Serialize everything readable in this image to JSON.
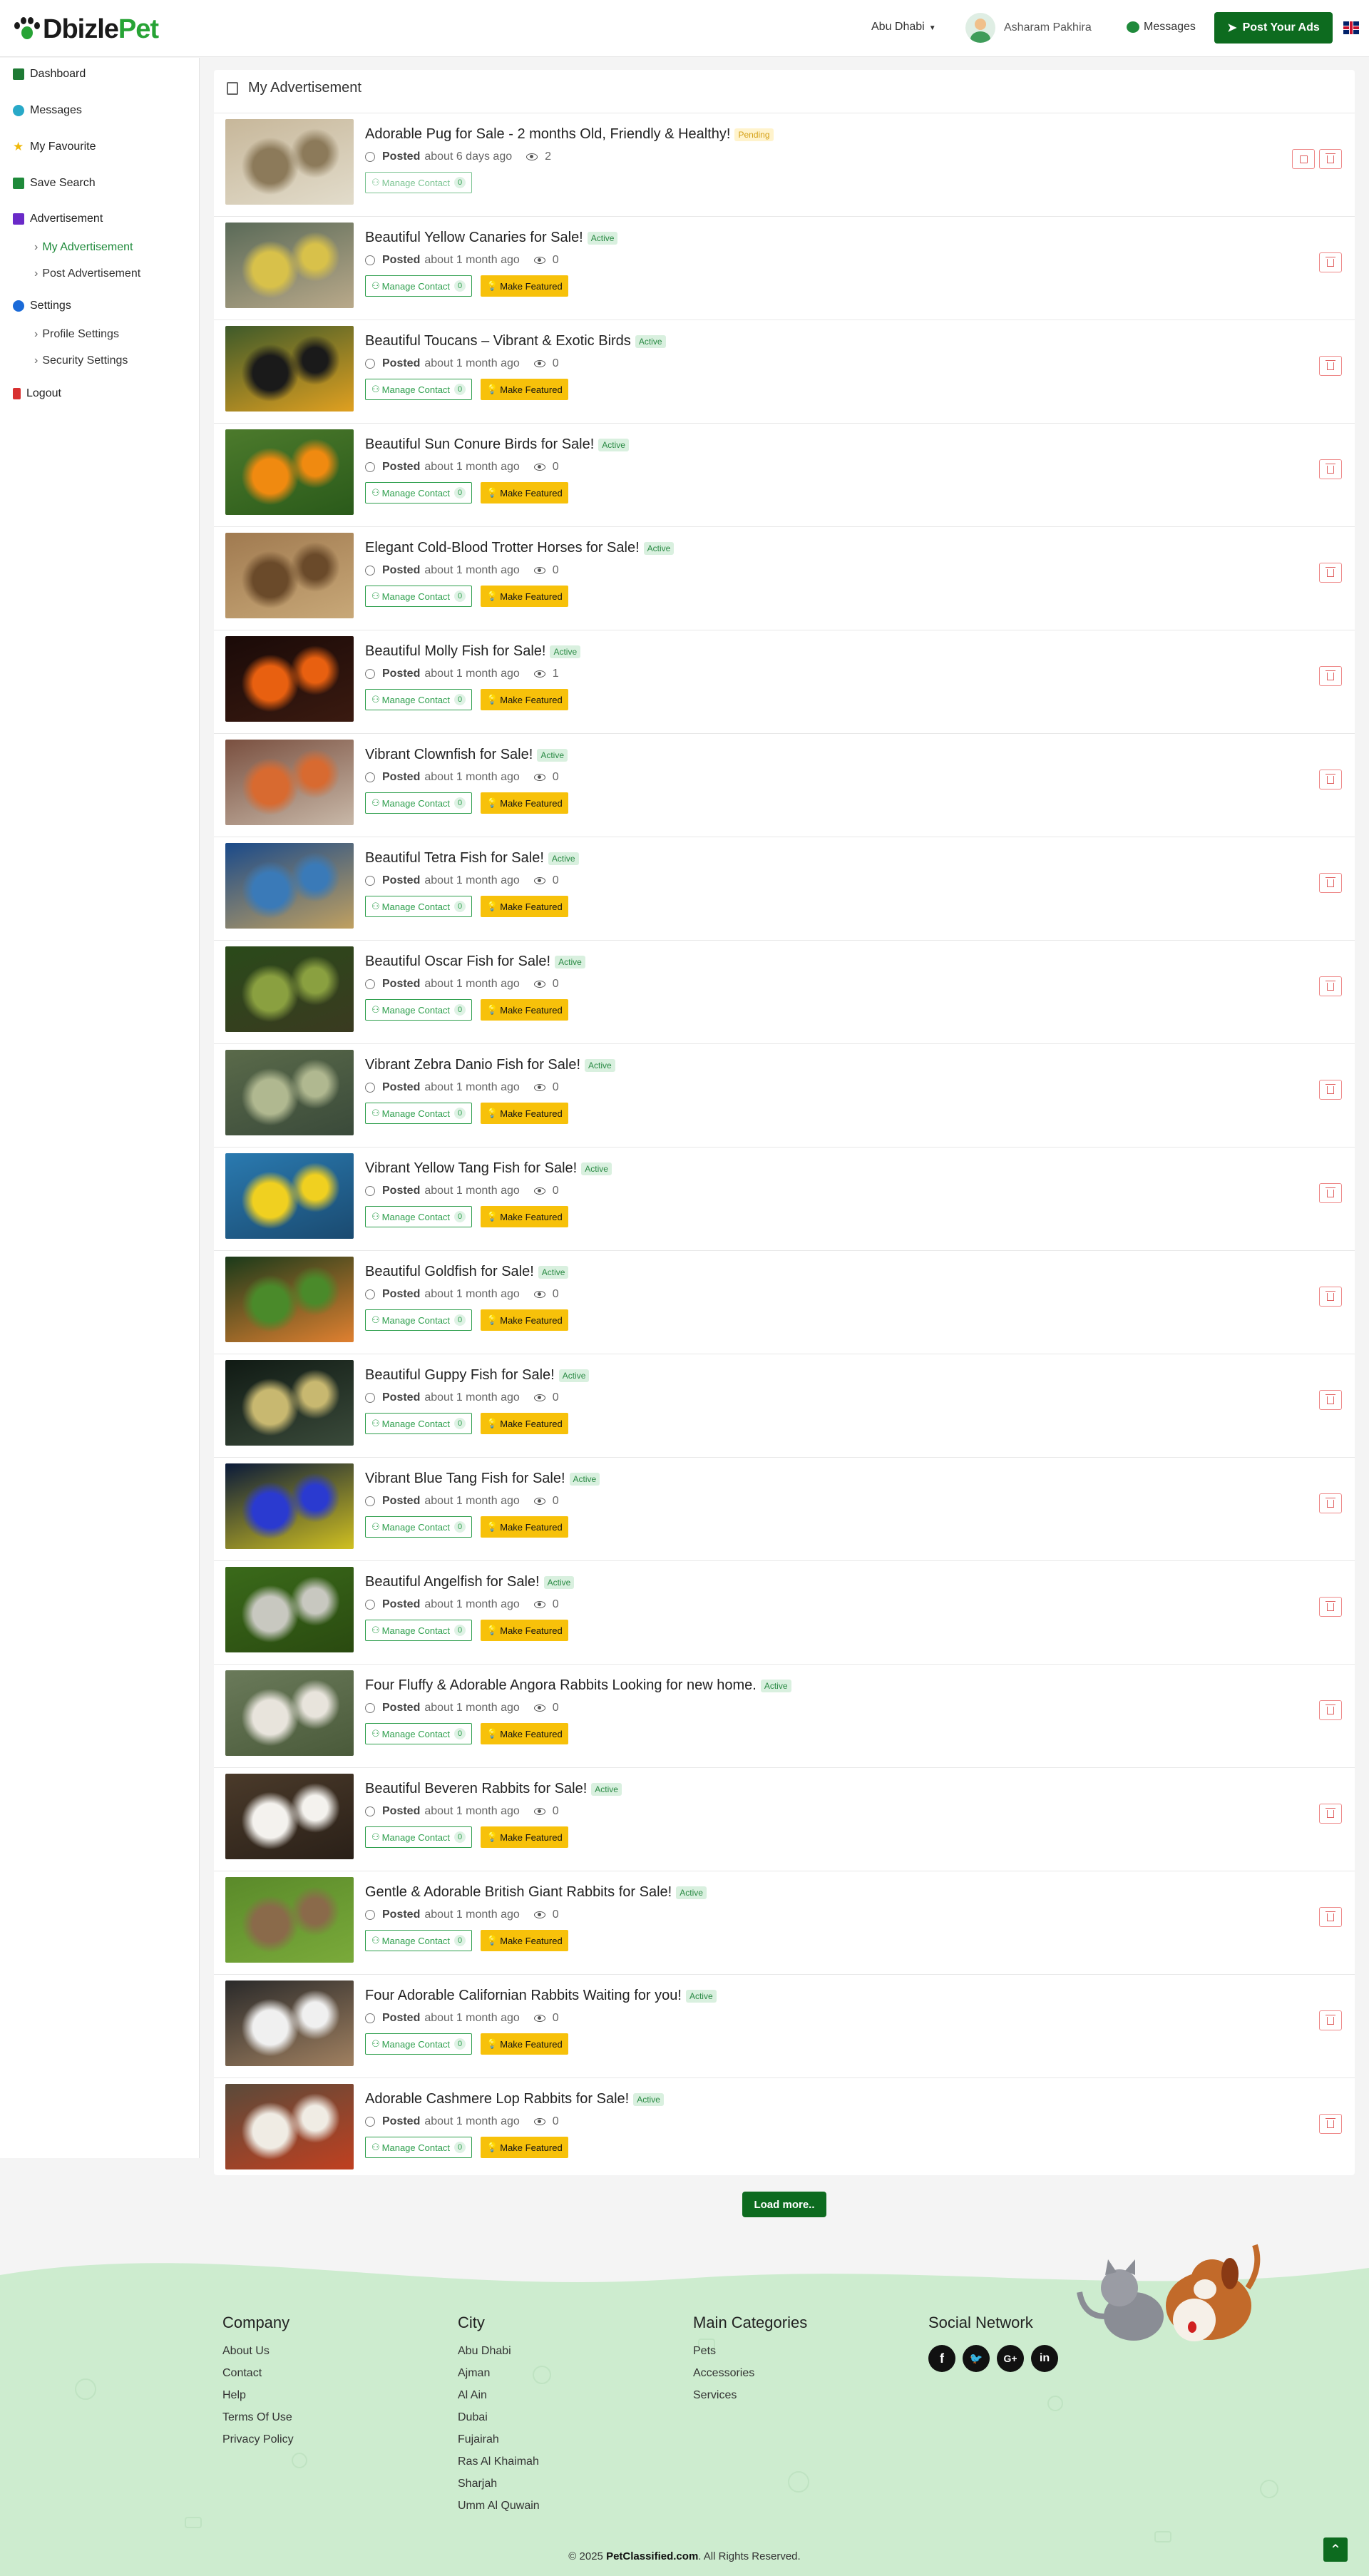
{
  "header": {
    "logo_part1": "Dbizle",
    "logo_part2": "Pet",
    "city": "Abu Dhabi",
    "username": "Asharam Pakhira",
    "messages_label": "Messages",
    "post_ads_label": "Post Your Ads"
  },
  "sidebar": {
    "dashboard": "Dashboard",
    "messages": "Messages",
    "favourite": "My Favourite",
    "save_search": "Save Search",
    "advertisement": "Advertisement",
    "my_advertisement": "My Advertisement",
    "post_advertisement": "Post Advertisement",
    "settings": "Settings",
    "profile_settings": "Profile Settings",
    "security_settings": "Security Settings",
    "logout": "Logout"
  },
  "main": {
    "title": "My Advertisement",
    "posted_label": "Posted",
    "manage_contact_label": "Manage Contact",
    "make_featured_label": "Make Featured",
    "load_more": "Load more..",
    "ads": [
      {
        "title": "Adorable Pug for Sale - 2 months Old, Friendly & Healthy!",
        "status": "Pending",
        "posted": "about 6 days ago",
        "views": "2",
        "contacts": "0",
        "thumb": [
          "#c7b79a",
          "#8c7a5a",
          "#e2dccb"
        ]
      },
      {
        "title": "Beautiful Yellow Canaries for Sale!",
        "status": "Active",
        "posted": "about 1 month ago",
        "views": "0",
        "contacts": "0",
        "thumb": [
          "#5a6a58",
          "#d8c14a",
          "#b9a98a"
        ]
      },
      {
        "title": "Beautiful Toucans – Vibrant & Exotic Birds",
        "status": "Active",
        "posted": "about 1 month ago",
        "views": "0",
        "contacts": "0",
        "thumb": [
          "#3e5a2a",
          "#1a1a1a",
          "#e0a020"
        ]
      },
      {
        "title": "Beautiful Sun Conure Birds for Sale!",
        "status": "Active",
        "posted": "about 1 month ago",
        "views": "0",
        "contacts": "0",
        "thumb": [
          "#4c7a2c",
          "#f08a10",
          "#2a5a1a"
        ]
      },
      {
        "title": "Elegant Cold-Blood Trotter Horses for Sale!",
        "status": "Active",
        "posted": "about 1 month ago",
        "views": "0",
        "contacts": "0",
        "thumb": [
          "#a07a50",
          "#6a4a2a",
          "#c8a878"
        ]
      },
      {
        "title": "Beautiful Molly Fish for Sale!",
        "status": "Active",
        "posted": "about 1 month ago",
        "views": "1",
        "contacts": "0",
        "thumb": [
          "#1a0a08",
          "#e86010",
          "#3a1a10"
        ]
      },
      {
        "title": "Vibrant Clownfish for Sale!",
        "status": "Active",
        "posted": "about 1 month ago",
        "views": "0",
        "contacts": "0",
        "thumb": [
          "#7a5040",
          "#d86a30",
          "#c8b8a8"
        ]
      },
      {
        "title": "Beautiful Tetra Fish for Sale!",
        "status": "Active",
        "posted": "about 1 month ago",
        "views": "0",
        "contacts": "0",
        "thumb": [
          "#1a4a8a",
          "#3a7ab8",
          "#c0a060"
        ]
      },
      {
        "title": "Beautiful Oscar Fish for Sale!",
        "status": "Active",
        "posted": "about 1 month ago",
        "views": "0",
        "contacts": "0",
        "thumb": [
          "#2a4a1a",
          "#8aa040",
          "#3a3a20"
        ]
      },
      {
        "title": "Vibrant Zebra Danio Fish for Sale!",
        "status": "Active",
        "posted": "about 1 month ago",
        "views": "0",
        "contacts": "0",
        "thumb": [
          "#5a6a4a",
          "#b0b890",
          "#3a4a3a"
        ]
      },
      {
        "title": "Vibrant Yellow Tang Fish for Sale!",
        "status": "Active",
        "posted": "about 1 month ago",
        "views": "0",
        "contacts": "0",
        "thumb": [
          "#2a7ab0",
          "#f0d020",
          "#1a4a70"
        ]
      },
      {
        "title": "Beautiful Goldfish for Sale!",
        "status": "Active",
        "posted": "about 1 month ago",
        "views": "0",
        "contacts": "0",
        "thumb": [
          "#1a3a1a",
          "#4a8a2a",
          "#e08030"
        ]
      },
      {
        "title": "Beautiful Guppy Fish for Sale!",
        "status": "Active",
        "posted": "about 1 month ago",
        "views": "0",
        "contacts": "0",
        "thumb": [
          "#101a14",
          "#c8b870",
          "#3a4a3a"
        ]
      },
      {
        "title": "Vibrant Blue Tang Fish for Sale!",
        "status": "Active",
        "posted": "about 1 month ago",
        "views": "0",
        "contacts": "0",
        "thumb": [
          "#0a1a3a",
          "#2a3ad0",
          "#d0c020"
        ]
      },
      {
        "title": "Beautiful Angelfish for Sale!",
        "status": "Active",
        "posted": "about 1 month ago",
        "views": "0",
        "contacts": "0",
        "thumb": [
          "#3a6a1a",
          "#c8c8c0",
          "#2a4a10"
        ]
      },
      {
        "title": "Four Fluffy & Adorable Angora Rabbits Looking for new home.",
        "status": "Active",
        "posted": "about 1 month ago",
        "views": "0",
        "contacts": "0",
        "thumb": [
          "#6a7a5a",
          "#e8e4dc",
          "#4a5a3a"
        ]
      },
      {
        "title": "Beautiful Beveren Rabbits for Sale!",
        "status": "Active",
        "posted": "about 1 month ago",
        "views": "0",
        "contacts": "0",
        "thumb": [
          "#4a3a2a",
          "#f4f2ee",
          "#2a2018"
        ]
      },
      {
        "title": "Gentle & Adorable British Giant Rabbits for Sale!",
        "status": "Active",
        "posted": "about 1 month ago",
        "views": "0",
        "contacts": "0",
        "thumb": [
          "#5a8a2a",
          "#8a6a4a",
          "#7aaa3a"
        ]
      },
      {
        "title": "Four Adorable Californian Rabbits Waiting for you!",
        "status": "Active",
        "posted": "about 1 month ago",
        "views": "0",
        "contacts": "0",
        "thumb": [
          "#2a2a2a",
          "#f0f0f0",
          "#a08060"
        ]
      },
      {
        "title": "Adorable Cashmere Lop Rabbits for Sale!",
        "status": "Active",
        "posted": "about 1 month ago",
        "views": "0",
        "contacts": "0",
        "thumb": [
          "#5a4a3a",
          "#f0ece4",
          "#c04020"
        ]
      }
    ]
  },
  "footer": {
    "company": {
      "heading": "Company",
      "links": [
        "About Us",
        "Contact",
        "Help",
        "Terms Of Use",
        "Privacy Policy"
      ]
    },
    "city": {
      "heading": "City",
      "links": [
        "Abu Dhabi",
        "Ajman",
        "Al Ain",
        "Dubai",
        "Fujairah",
        "Ras Al Khaimah",
        "Sharjah",
        "Umm Al Quwain"
      ]
    },
    "categories": {
      "heading": "Main Categories",
      "links": [
        "Pets",
        "Accessories",
        "Services"
      ]
    },
    "social": {
      "heading": "Social Network",
      "icons": [
        "facebook-icon",
        "twitter-icon",
        "google-plus-icon",
        "linkedin-icon"
      ]
    },
    "copyright_prefix": "© 2025",
    "copyright_brand": "PetClassified.com",
    "copyright_suffix": ". All Rights Reserved."
  },
  "colors": {
    "brand_green": "#0d6b1f",
    "active_badge": "#2a8a44",
    "pending_badge": "#d4a017",
    "featured": "#f7c10a",
    "footer_bg": "#cdeccf"
  }
}
